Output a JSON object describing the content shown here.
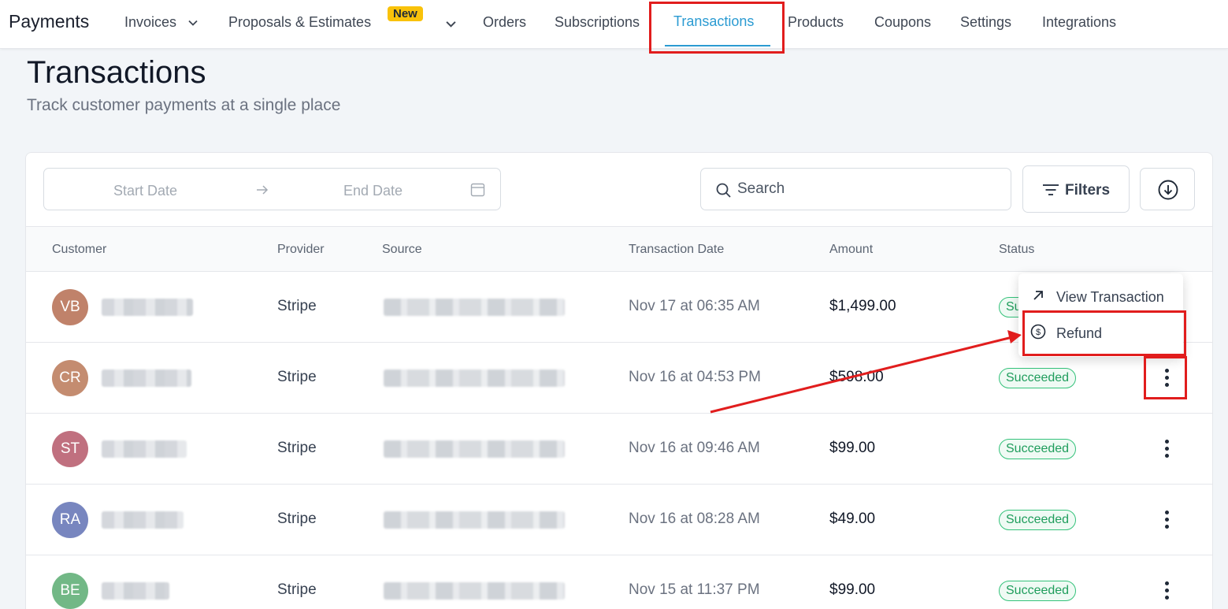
{
  "nav": {
    "brand": "Payments",
    "items": [
      {
        "label": "Invoices",
        "has_chevron": true
      },
      {
        "label": "Proposals & Estimates",
        "badge": "New",
        "has_chevron": true
      },
      {
        "label": "Orders"
      },
      {
        "label": "Subscriptions"
      },
      {
        "label": "Transactions",
        "active": true
      },
      {
        "label": "Products"
      },
      {
        "label": "Coupons"
      },
      {
        "label": "Settings"
      },
      {
        "label": "Integrations"
      }
    ],
    "accent_color": "#2b9bd2"
  },
  "page": {
    "title": "Transactions",
    "subtitle": "Track customer payments at a single place"
  },
  "toolbar": {
    "start_date_placeholder": "Start Date",
    "end_date_placeholder": "End Date",
    "search_placeholder": "Search",
    "filters_label": "Filters"
  },
  "table": {
    "columns": [
      "Customer",
      "Provider",
      "Source",
      "Transaction Date",
      "Amount",
      "Status"
    ],
    "rows": [
      {
        "initials": "VB",
        "avatar_color": "#c0826a",
        "provider": "Stripe",
        "date": "Nov 17 at 06:35 AM",
        "amount": "$1,499.00",
        "status": "Succeeded"
      },
      {
        "initials": "CR",
        "avatar_color": "#c48c70",
        "provider": "Stripe",
        "date": "Nov 16 at 04:53 PM",
        "amount": "$598.00",
        "status": "Succeeded"
      },
      {
        "initials": "ST",
        "avatar_color": "#c0707f",
        "provider": "Stripe",
        "date": "Nov 16 at 09:46 AM",
        "amount": "$99.00",
        "status": "Succeeded"
      },
      {
        "initials": "RA",
        "avatar_color": "#7886bf",
        "provider": "Stripe",
        "date": "Nov 16 at 08:28 AM",
        "amount": "$49.00",
        "status": "Succeeded"
      },
      {
        "initials": "BE",
        "avatar_color": "#72b886",
        "provider": "Stripe",
        "date": "Nov 15 at 11:37 PM",
        "amount": "$99.00",
        "status": "Succeeded"
      }
    ],
    "status_color": "#1f9d5c"
  },
  "row_menu": {
    "items": [
      {
        "label": "View Transaction",
        "icon": "arrow-up-right-icon"
      },
      {
        "label": "Refund",
        "icon": "dollar-circle-icon"
      }
    ]
  },
  "annotations": {
    "highlight_color": "#e11d1d"
  }
}
